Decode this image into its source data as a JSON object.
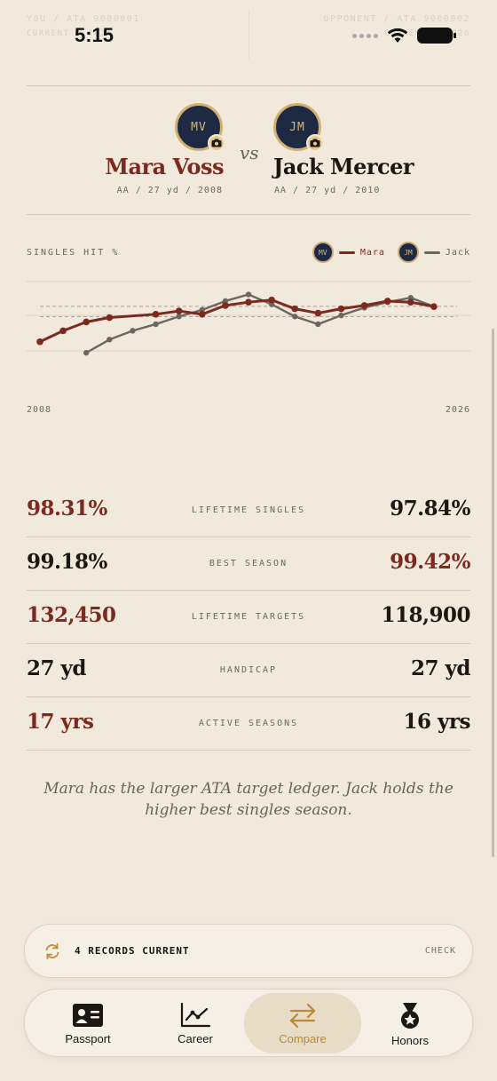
{
  "status_bar": {
    "time": "5:15",
    "ghost_left_line1": "YOU / ATA 9000001",
    "ghost_left_line2": "CURRENT / 2026",
    "ghost_right_line1": "OPPONENT / ATA 9000002",
    "ghost_right_line2": "CURRENT / 2026"
  },
  "matchup": {
    "vs_label": "vs",
    "player1": {
      "initials": "MV",
      "name": "Mara Voss",
      "meta": "AA / 27 yd / 2008",
      "color": "#7c2a1f"
    },
    "player2": {
      "initials": "JM",
      "name": "Jack Mercer",
      "meta": "AA / 27 yd / 2010",
      "color": "#6b6760"
    }
  },
  "chart_data": {
    "type": "line",
    "title": "SINGLES HIT %",
    "x_start_label": "2008",
    "x_end_label": "2026",
    "xlim": [
      2008,
      2026
    ],
    "ylim": [
      95.6,
      99.8
    ],
    "reference_lines": [
      98.31,
      97.84
    ],
    "series": [
      {
        "name": "Mara",
        "initials": "MV",
        "color": "#7c2a1f",
        "x": [
          2008,
          2009,
          2010,
          2011,
          2013,
          2014,
          2015,
          2016,
          2017,
          2018,
          2019,
          2020,
          2021,
          2022,
          2023,
          2024,
          2025
        ],
        "y": [
          96.7,
          97.2,
          97.6,
          97.8,
          97.95,
          98.1,
          97.95,
          98.35,
          98.5,
          98.6,
          98.2,
          98.0,
          98.2,
          98.35,
          98.55,
          98.5,
          98.3
        ]
      },
      {
        "name": "Jack",
        "initials": "JM",
        "color": "#6b6760",
        "x": [
          2010,
          2011,
          2012,
          2013,
          2014,
          2015,
          2016,
          2017,
          2018,
          2019,
          2020,
          2021,
          2022,
          2023,
          2024,
          2025
        ],
        "y": [
          96.2,
          96.8,
          97.2,
          97.5,
          97.85,
          98.15,
          98.55,
          98.85,
          98.4,
          97.85,
          97.5,
          97.9,
          98.25,
          98.5,
          98.7,
          98.3
        ]
      }
    ]
  },
  "stats": [
    {
      "label": "LIFETIME SINGLES",
      "left": "98.31%",
      "right": "97.84%",
      "highlight": "left"
    },
    {
      "label": "BEST SEASON",
      "left": "99.18%",
      "right": "99.42%",
      "highlight": "right"
    },
    {
      "label": "LIFETIME TARGETS",
      "left": "132,450",
      "right": "118,900",
      "highlight": "left"
    },
    {
      "label": "HANDICAP",
      "left": "27 yd",
      "right": "27 yd",
      "highlight": "none"
    },
    {
      "label": "ACTIVE SEASONS",
      "left": "17 yrs",
      "right": "16 yrs",
      "highlight": "left"
    }
  ],
  "summary": "Mara has the larger ATA target ledger. Jack holds the higher best singles season.",
  "records": {
    "text": "4 RECORDS CURRENT",
    "action": "CHECK",
    "icon": "sync-icon"
  },
  "tabs": [
    {
      "label": "Passport",
      "icon": "id-card-icon",
      "active": false
    },
    {
      "label": "Career",
      "icon": "line-chart-icon",
      "active": false
    },
    {
      "label": "Compare",
      "icon": "swap-arrows-icon",
      "active": true
    },
    {
      "label": "Honors",
      "icon": "medal-icon",
      "active": false
    }
  ],
  "colors": {
    "background": "#f1e9dc",
    "accent": "#7c2a1f",
    "gold": "#b88a3a",
    "navy": "#1e2a44"
  }
}
